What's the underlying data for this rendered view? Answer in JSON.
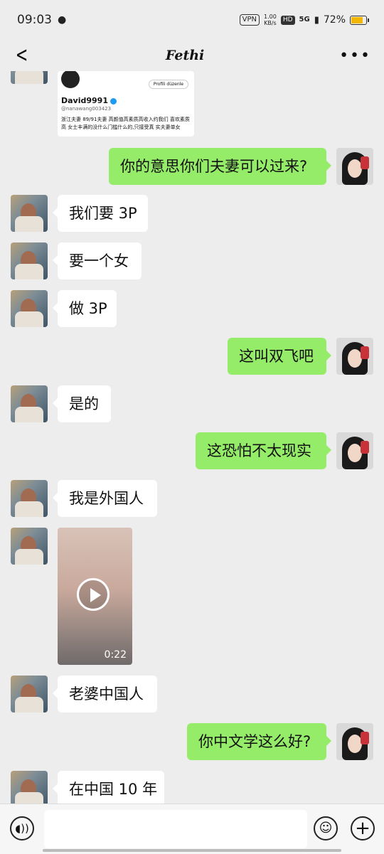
{
  "status_bar": {
    "time": "09:03",
    "vpn": "VPN",
    "speed_value": "1.00",
    "speed_unit": "KB/s",
    "hd": "HD",
    "network": "5G",
    "battery_percent": "72%",
    "battery_level": 0.72
  },
  "header": {
    "title": "Fethi",
    "back_icon": "back-chevron-icon",
    "more_icon": "more-icon"
  },
  "shared_profile": {
    "edit_button": "Profili düzenle",
    "username": "David9991",
    "handle": "@nanawang003423",
    "bio": "浙江夫妻 89/91夫妻 高颜值高素质高收入约我们 喜欢素质高 女士丰满的没什么门槛什么的,只接受真 实夫妻单女"
  },
  "messages": [
    {
      "side": "out",
      "text": "你的意思你们夫妻可以过来?"
    },
    {
      "side": "in",
      "text": "我们要 3P"
    },
    {
      "side": "in",
      "text": "要一个女"
    },
    {
      "side": "in",
      "text": "做 3P"
    },
    {
      "side": "out",
      "text": "这叫双飞吧"
    },
    {
      "side": "in",
      "text": "是的"
    },
    {
      "side": "out",
      "text": "这恐怕不太现实"
    },
    {
      "side": "in",
      "text": "我是外国人"
    },
    {
      "side": "in",
      "type": "video",
      "duration": "0:22"
    },
    {
      "side": "in",
      "text": "老婆中国人"
    },
    {
      "side": "out",
      "text": "你中文学这么好?"
    },
    {
      "side": "in",
      "text": "在中国 10 年"
    }
  ],
  "input_bar": {
    "voice_icon": "voice-icon",
    "emoji_icon": "emoji-icon",
    "plus_icon": "plus-icon",
    "placeholder": ""
  }
}
